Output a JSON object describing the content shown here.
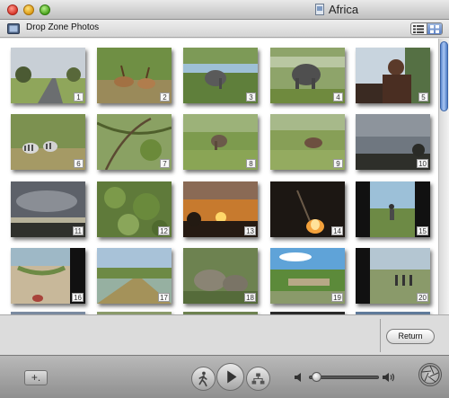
{
  "window": {
    "title": "Africa"
  },
  "header": {
    "title": "Drop Zone Photos"
  },
  "view_modes": [
    "list-view-icon",
    "grid-view-icon"
  ],
  "photos": [
    {
      "n": "1",
      "scene": "road"
    },
    {
      "n": "2",
      "scene": "antelope"
    },
    {
      "n": "3",
      "scene": "elephant"
    },
    {
      "n": "4",
      "scene": "elephant-big"
    },
    {
      "n": "5",
      "scene": "portrait"
    },
    {
      "n": "6",
      "scene": "zebras"
    },
    {
      "n": "7",
      "scene": "bush"
    },
    {
      "n": "8",
      "scene": "grass-animals"
    },
    {
      "n": "9",
      "scene": "grass-animal"
    },
    {
      "n": "10",
      "scene": "dusk-tree"
    },
    {
      "n": "11",
      "scene": "dusk-cloud"
    },
    {
      "n": "12",
      "scene": "leaves"
    },
    {
      "n": "13",
      "scene": "sunset"
    },
    {
      "n": "14",
      "scene": "campfire"
    },
    {
      "n": "15",
      "scene": "hiker"
    },
    {
      "n": "16",
      "scene": "river-feet"
    },
    {
      "n": "17",
      "scene": "dirt-road"
    },
    {
      "n": "18",
      "scene": "rocks"
    },
    {
      "n": "19",
      "scene": "lodge"
    },
    {
      "n": "20",
      "scene": "people-walk"
    }
  ],
  "lower": {
    "return_label": "Return"
  },
  "toolbar": {
    "add_label": "+."
  },
  "volume": {
    "level": 0.05
  },
  "colors": {
    "scroll_accent": "#5d88cf",
    "window_bg": "#e8e8e8"
  }
}
